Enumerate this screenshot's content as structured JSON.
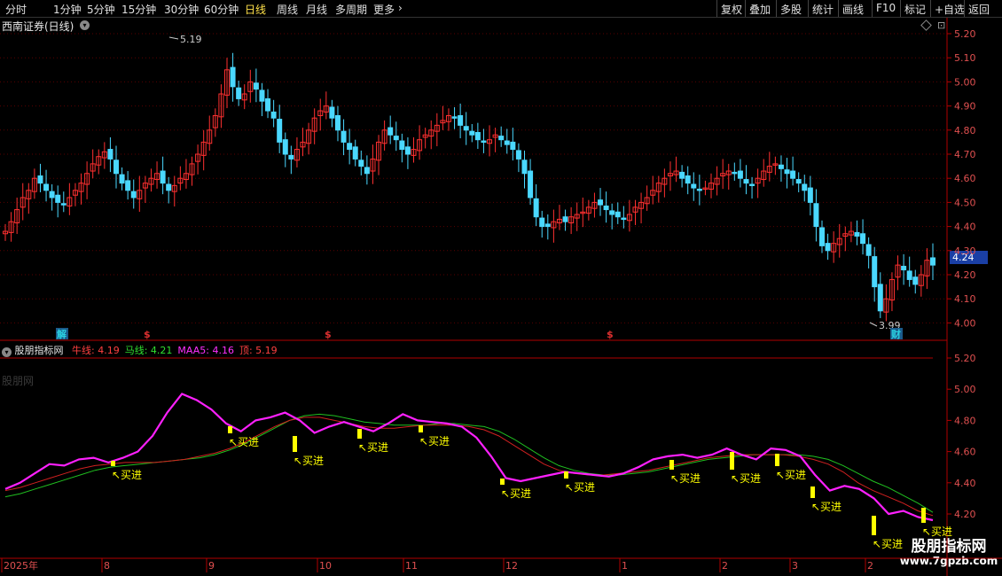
{
  "toolbar": {
    "periods": [
      "分时",
      "1分钟",
      "5分钟",
      "15分钟",
      "30分钟",
      "60分钟",
      "日线",
      "周线",
      "月线",
      "多周期",
      "更多"
    ],
    "active_period": "日线",
    "more_arrow": "›",
    "right_buttons": [
      "复权",
      "叠加",
      "多股",
      "统计",
      "画线",
      "F10",
      "标记",
      "+自选",
      "返回"
    ]
  },
  "stock_title": "西南证券(日线)",
  "price_axis": [
    "5.20",
    "5.10",
    "5.00",
    "4.90",
    "4.80",
    "4.70",
    "4.60",
    "4.50",
    "4.40",
    "4.30",
    "4.20",
    "4.10",
    "4.00"
  ],
  "current_price": "4.24",
  "high_label": "5.19",
  "low_label": "3.99",
  "markers": [
    {
      "text": "解",
      "color": "#2ad0e0"
    },
    {
      "text": "$",
      "color": "#e03030"
    },
    {
      "text": "$",
      "color": "#e03030"
    },
    {
      "text": "$",
      "color": "#e03030"
    },
    {
      "text": "财",
      "color": "#2ad0e0"
    }
  ],
  "indicator": {
    "name": "股朋指标网",
    "items": [
      {
        "label": "牛线:",
        "value": "4.19",
        "color": "#ff4040"
      },
      {
        "label": "马线:",
        "value": "4.21",
        "color": "#30e030"
      },
      {
        "label": "MAA5:",
        "value": "4.16",
        "color": "#ff30ff"
      },
      {
        "label": "顶:",
        "value": "5.19",
        "color": "#ff4040"
      }
    ],
    "watermark": "股朋网",
    "axis": [
      "5.20",
      "5.00",
      "4.80",
      "4.60",
      "4.40",
      "4.20"
    ],
    "buy_label": "买进"
  },
  "date_axis": [
    "2025年",
    "8",
    "9",
    "10",
    "11",
    "12",
    "1",
    "2",
    "3",
    "2"
  ],
  "brand": {
    "title": "股朋指标网",
    "url": "www.7gpzb.com"
  },
  "colors": {
    "up": "#ff3030",
    "down": "#4ad8ff",
    "frame": "#b00000",
    "bull": "#d02020",
    "horse": "#20c020",
    "maa5": "#ff20ff",
    "buy": "#ffff00"
  },
  "chart_data": {
    "type": "candlestick",
    "ylim": [
      3.95,
      5.25
    ],
    "closes": [
      4.38,
      4.42,
      4.47,
      4.52,
      4.55,
      4.6,
      4.58,
      4.55,
      4.52,
      4.5,
      4.49,
      4.52,
      4.55,
      4.58,
      4.62,
      4.66,
      4.69,
      4.71,
      4.68,
      4.62,
      4.58,
      4.55,
      4.52,
      4.55,
      4.58,
      4.6,
      4.62,
      4.58,
      4.55,
      4.57,
      4.6,
      4.62,
      4.66,
      4.7,
      4.75,
      4.8,
      4.86,
      4.95,
      5.05,
      4.98,
      4.93,
      4.95,
      5.0,
      4.97,
      4.92,
      4.88,
      4.85,
      4.75,
      4.7,
      4.68,
      4.72,
      4.75,
      4.8,
      4.85,
      4.88,
      4.9,
      4.85,
      4.8,
      4.75,
      4.72,
      4.68,
      4.65,
      4.62,
      4.68,
      4.75,
      4.8,
      4.78,
      4.76,
      4.72,
      4.7,
      4.72,
      4.76,
      4.78,
      4.8,
      4.82,
      4.84,
      4.86,
      4.85,
      4.82,
      4.8,
      4.78,
      4.76,
      4.75,
      4.76,
      4.78,
      4.76,
      4.74,
      4.72,
      4.68,
      4.62,
      4.52,
      4.44,
      4.4,
      4.4,
      4.42,
      4.43,
      4.42,
      4.44,
      4.45,
      4.46,
      4.48,
      4.5,
      4.49,
      4.47,
      4.45,
      4.44,
      4.43,
      4.45,
      4.48,
      4.5,
      4.52,
      4.55,
      4.58,
      4.6,
      4.62,
      4.63,
      4.6,
      4.58,
      4.56,
      4.55,
      4.56,
      4.58,
      4.6,
      4.62,
      4.63,
      4.62,
      4.6,
      4.58,
      4.57,
      4.6,
      4.63,
      4.65,
      4.66,
      4.64,
      4.62,
      4.6,
      4.58,
      4.55,
      4.5,
      4.4,
      4.32,
      4.3,
      4.33,
      4.35,
      4.37,
      4.38,
      4.36,
      4.33,
      4.28,
      4.15,
      4.05,
      4.1,
      4.18,
      4.24,
      4.22,
      4.18,
      4.16,
      4.2,
      4.26,
      4.24
    ],
    "bull_line": [
      4.35,
      4.37,
      4.4,
      4.43,
      4.46,
      4.49,
      4.51,
      4.52,
      4.53,
      4.53,
      4.53,
      4.54,
      4.55,
      4.57,
      4.59,
      4.62,
      4.66,
      4.71,
      4.76,
      4.8,
      4.82,
      4.82,
      4.8,
      4.78,
      4.76,
      4.75,
      4.75,
      4.76,
      4.77,
      4.77,
      4.77,
      4.76,
      4.74,
      4.7,
      4.64,
      4.58,
      4.52,
      4.48,
      4.46,
      4.45,
      4.45,
      4.46,
      4.47,
      4.48,
      4.5,
      4.52,
      4.54,
      4.56,
      4.57,
      4.58,
      4.58,
      4.58,
      4.58,
      4.57,
      4.55,
      4.52,
      4.47,
      4.4,
      4.35,
      4.31,
      4.27,
      4.22,
      4.19
    ],
    "horse_line": [
      4.31,
      4.33,
      4.36,
      4.39,
      4.42,
      4.45,
      4.48,
      4.5,
      4.51,
      4.52,
      4.53,
      4.54,
      4.55,
      4.56,
      4.58,
      4.61,
      4.65,
      4.7,
      4.75,
      4.8,
      4.83,
      4.84,
      4.83,
      4.81,
      4.79,
      4.78,
      4.77,
      4.77,
      4.77,
      4.78,
      4.78,
      4.77,
      4.76,
      4.73,
      4.68,
      4.62,
      4.56,
      4.51,
      4.48,
      4.46,
      4.45,
      4.45,
      4.46,
      4.47,
      4.49,
      4.51,
      4.53,
      4.55,
      4.56,
      4.57,
      4.58,
      4.58,
      4.58,
      4.58,
      4.57,
      4.55,
      4.51,
      4.46,
      4.41,
      4.37,
      4.32,
      4.27,
      4.21
    ],
    "maa5_line": [
      4.36,
      4.4,
      4.46,
      4.52,
      4.51,
      4.55,
      4.56,
      4.53,
      4.56,
      4.6,
      4.7,
      4.85,
      4.97,
      4.93,
      4.87,
      4.78,
      4.73,
      4.8,
      4.82,
      4.85,
      4.8,
      4.72,
      4.76,
      4.79,
      4.76,
      4.73,
      4.78,
      4.84,
      4.8,
      4.79,
      4.78,
      4.76,
      4.69,
      4.57,
      4.43,
      4.41,
      4.43,
      4.45,
      4.47,
      4.46,
      4.45,
      4.44,
      4.46,
      4.5,
      4.55,
      4.57,
      4.58,
      4.56,
      4.58,
      4.62,
      4.58,
      4.55,
      4.62,
      4.61,
      4.57,
      4.45,
      4.35,
      4.38,
      4.36,
      4.3,
      4.2,
      4.22,
      4.18,
      4.16
    ]
  }
}
